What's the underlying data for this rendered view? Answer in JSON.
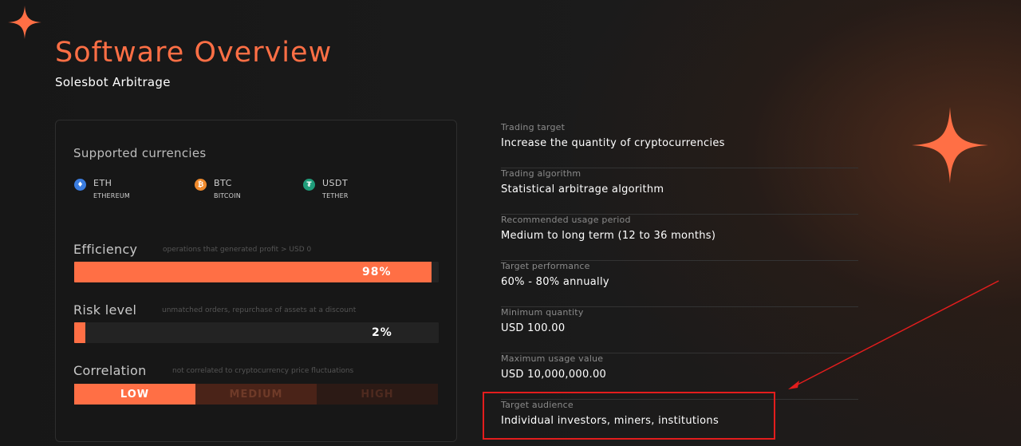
{
  "header": {
    "title": "Software Overview",
    "subtitle": "Solesbot Arbitrage"
  },
  "currencies": {
    "title": "Supported currencies",
    "items": [
      {
        "code": "ETH",
        "name": "ETHEREUM",
        "icon": "ethereum-icon",
        "color": "#3b7de0",
        "glyph": "♦"
      },
      {
        "code": "BTC",
        "name": "BITCOIN",
        "icon": "bitcoin-icon",
        "color": "#f08a2c",
        "glyph": "₿"
      },
      {
        "code": "USDT",
        "name": "TETHER",
        "icon": "tether-icon",
        "color": "#1f9c7a",
        "glyph": "₮"
      }
    ]
  },
  "metrics": {
    "efficiency": {
      "label": "Efficiency",
      "note": "operations that generated profit > USD 0",
      "value": "98%",
      "fill": 0.98
    },
    "risk": {
      "label": "Risk level",
      "note": "unmatched orders, repurchase of assets at a discount",
      "value": "2%",
      "fill": 0.02
    },
    "correlation": {
      "label": "Correlation",
      "note": "not correlated to cryptocurrency price fluctuations",
      "levels": [
        "LOW",
        "MEDIUM",
        "HIGH"
      ],
      "selected": "LOW"
    }
  },
  "details": [
    {
      "label": "Trading target",
      "value": "Increase the quantity of cryptocurrencies"
    },
    {
      "label": "Trading algorithm",
      "value": "Statistical arbitrage algorithm"
    },
    {
      "label": "Recommended usage period",
      "value": "Medium to long term (12 to 36 months)"
    },
    {
      "label": "Target performance",
      "value": "60% - 80% annually"
    },
    {
      "label": "Minimum quantity",
      "value": "USD 100.00"
    },
    {
      "label": "Maximum usage value",
      "value": "USD 10,000,000.00"
    },
    {
      "label": "Target audience",
      "value": "Individual investors, miners, institutions"
    }
  ],
  "colors": {
    "accent": "#ff6f45",
    "annotation": "#e31d1d"
  }
}
